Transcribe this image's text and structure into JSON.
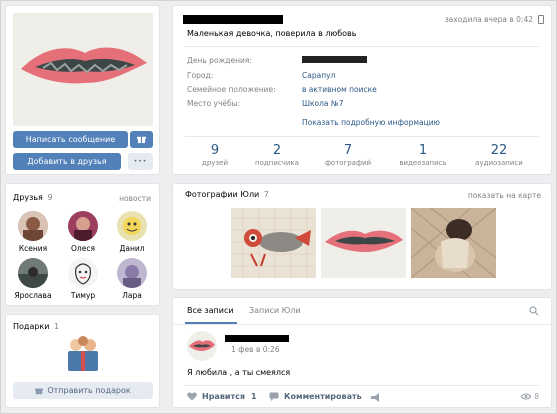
{
  "status": "Маленькая девочка, поверила в любовь",
  "last_seen": "заходила вчера в 0:42",
  "info": {
    "rows": [
      {
        "label": "День рождения:",
        "value": ""
      },
      {
        "label": "Город:",
        "value": "Сарапул"
      },
      {
        "label": "Семейное положение:",
        "value": "в активном поиске"
      },
      {
        "label": "Место учёбы:",
        "value": "Школа №7"
      }
    ],
    "more": "Показать подробную информацию"
  },
  "stats": [
    {
      "num": "9",
      "label": "друзей"
    },
    {
      "num": "2",
      "label": "подписчика"
    },
    {
      "num": "7",
      "label": "фотографий"
    },
    {
      "num": "1",
      "label": "видеозапись"
    },
    {
      "num": "22",
      "label": "аудиозаписи"
    }
  ],
  "buttons": {
    "message": "Написать сообщение",
    "add_friend": "Добавить в друзья",
    "more": "•••",
    "gift": "Отправить подарок"
  },
  "friends": {
    "title": "Друзья",
    "count": "9",
    "news": "новости",
    "items": [
      {
        "name": "Ксения"
      },
      {
        "name": "Олеся"
      },
      {
        "name": "Данил"
      },
      {
        "name": "Ярослава"
      },
      {
        "name": "Тимур"
      },
      {
        "name": "Лара"
      }
    ]
  },
  "gifts": {
    "title": "Подарки",
    "count": "1"
  },
  "photos": {
    "title": "Фотографии Юли",
    "count": "7",
    "map": "показать на карте"
  },
  "wall": {
    "tabs": [
      "Все записи",
      "Записи Юли"
    ],
    "post_date": "1 фев в 0:26",
    "post_text": "Я любила , а ты смеялся",
    "like_label": "Нравится",
    "like_count": "1",
    "comment_label": "Комментировать",
    "views": "8"
  },
  "colors": {
    "accent": "#5181b8",
    "link": "#2a5885",
    "muted": "#828282",
    "bg": "#edeef0"
  }
}
